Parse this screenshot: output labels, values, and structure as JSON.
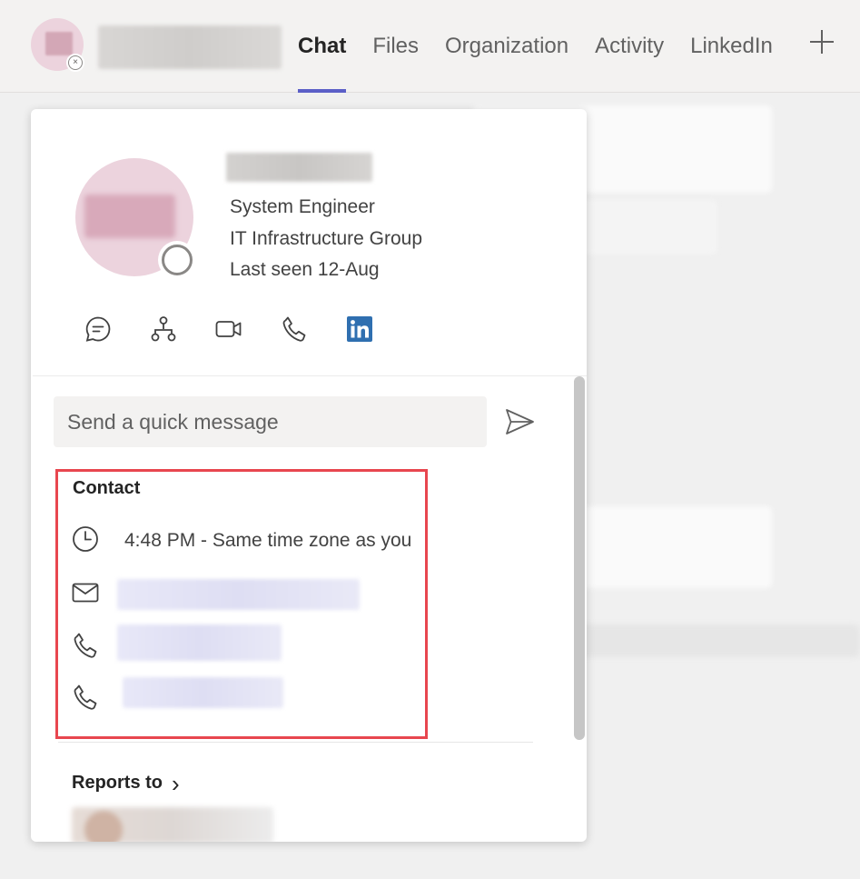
{
  "header": {
    "tabs": [
      {
        "label": "Chat",
        "active": true
      },
      {
        "label": "Files",
        "active": false
      },
      {
        "label": "Organization",
        "active": false
      },
      {
        "label": "Activity",
        "active": false
      },
      {
        "label": "LinkedIn",
        "active": false
      }
    ],
    "status_glyph": "×",
    "add_icon": "plus-icon"
  },
  "profile": {
    "title": "System Engineer",
    "department": "IT Infrastructure Group",
    "last_seen": "Last seen 12-Aug",
    "actions": [
      "chat-icon",
      "org-chart-icon",
      "video-call-icon",
      "phone-icon",
      "linkedin-icon"
    ]
  },
  "quick_message": {
    "placeholder": "Send a quick message"
  },
  "contact": {
    "heading": "Contact",
    "local_time": "4:48 PM - Same time zone as you"
  },
  "reports_to": {
    "heading": "Reports to",
    "chevron": "›"
  },
  "colors": {
    "accent": "#5b5fc7",
    "highlight_border": "#e8464f",
    "linkedin": "#2f6fb0"
  }
}
